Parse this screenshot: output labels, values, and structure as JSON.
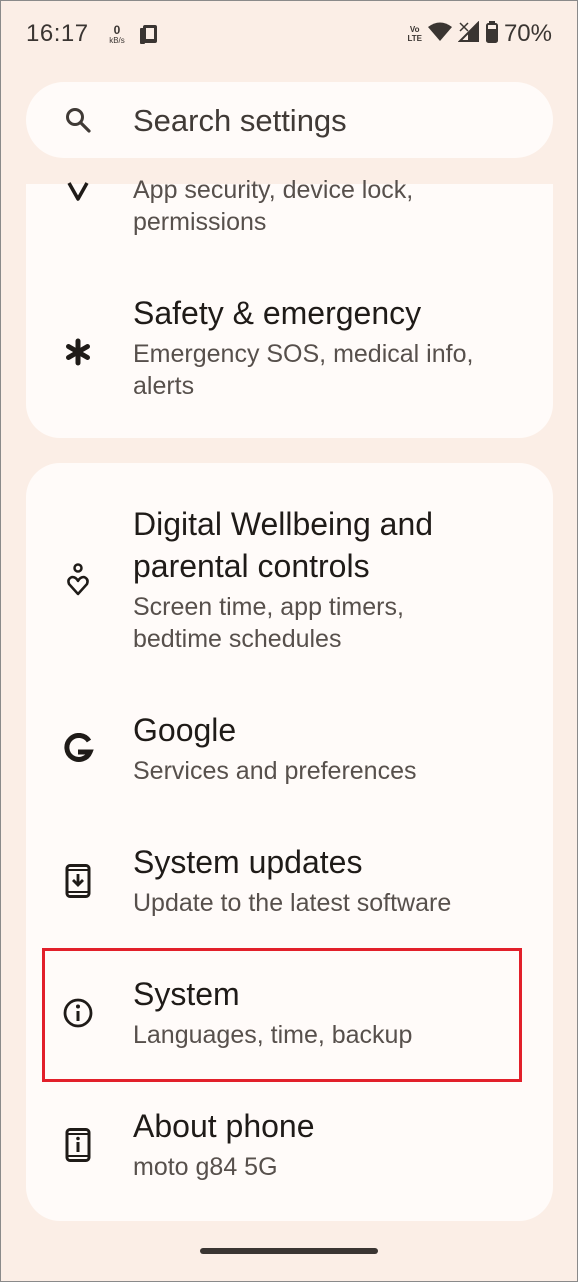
{
  "status_bar": {
    "time": "16:17",
    "net_speed_value": "0",
    "net_speed_unit": "kB/s",
    "volte_top": "Vo",
    "volte_bottom": "LTE",
    "battery": "70%"
  },
  "search": {
    "placeholder": "Search settings"
  },
  "card1": {
    "items": [
      {
        "icon": "shield-lock-icon",
        "subtitle_line1": "App security, device lock,",
        "subtitle_line2": "permissions"
      },
      {
        "icon": "asterisk-icon",
        "title": "Safety & emergency",
        "subtitle_line1": "Emergency SOS, medical info,",
        "subtitle_line2": "alerts"
      }
    ]
  },
  "card2": {
    "items": [
      {
        "icon": "wellbeing-icon",
        "title_line1": "Digital Wellbeing and",
        "title_line2": "parental controls",
        "subtitle_line1": "Screen time, app timers,",
        "subtitle_line2": "bedtime schedules"
      },
      {
        "icon": "google-icon",
        "title": "Google",
        "subtitle": "Services and preferences"
      },
      {
        "icon": "system-update-icon",
        "title": "System updates",
        "subtitle": "Update to the latest software"
      },
      {
        "icon": "info-icon",
        "title": "System",
        "subtitle": "Languages, time, backup"
      },
      {
        "icon": "phone-info-icon",
        "title": "About phone",
        "subtitle": "moto g84 5G"
      }
    ]
  },
  "colors": {
    "background": "#fbeee6",
    "card": "#fffbf9",
    "highlight": "#e21f2a"
  }
}
